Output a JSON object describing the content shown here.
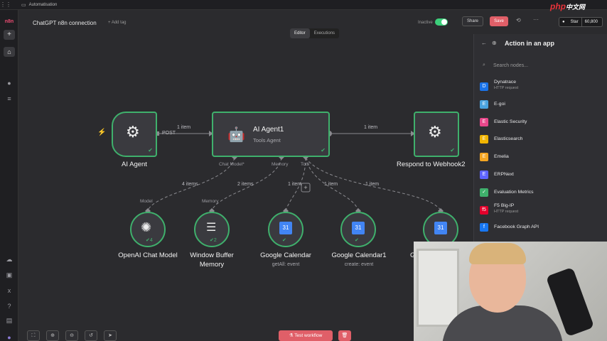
{
  "topbar": {
    "breadcrumb": "Automatisation"
  },
  "header": {
    "title": "ChatGPT n8n connection",
    "add_tag": "+ Add tag",
    "inactive": "Inactive",
    "share": "Share",
    "save": "Save",
    "star": "Star",
    "star_count": "60,800"
  },
  "tabs": {
    "editor": "Editor",
    "executions": "Executions"
  },
  "nodes": {
    "trigger": {
      "label": "AI Agent",
      "port_label": "POST"
    },
    "agent": {
      "label": "AI Agent1",
      "sub": "Tools Agent",
      "ports": [
        "Chat Model*",
        "Memory",
        "Tool"
      ]
    },
    "respond": {
      "label": "Respond to Webhook2"
    },
    "openai": {
      "label": "OpenAI Chat Model",
      "port": "Model",
      "count": "4"
    },
    "memory": {
      "label": "Window Buffer",
      "label2": "Memory",
      "port": "Memory",
      "count": "2"
    },
    "gcal": {
      "label": "Google Calendar",
      "sub": "getAll: event"
    },
    "gcal1": {
      "label": "Google Calendar1",
      "sub": "create: event"
    },
    "gcal2": {
      "label": "G"
    }
  },
  "edges": {
    "e1": "1 item",
    "e2": "1 item",
    "e3": "4 items",
    "e4": "2 items",
    "e5": "1 item",
    "e6": "1 item",
    "e7": "1 item"
  },
  "toolbar": {
    "test": "Test workflow"
  },
  "panel": {
    "title": "Action in an app",
    "search_placeholder": "Search nodes...",
    "items": [
      {
        "name": "Dynatrace",
        "desc": "HTTP request",
        "color": "#1a73e8",
        "icon": "D"
      },
      {
        "name": "E-goi",
        "desc": "",
        "color": "#4aa3df",
        "icon": "E"
      },
      {
        "name": "Elastic Security",
        "desc": "",
        "color": "#e8478b",
        "icon": "E"
      },
      {
        "name": "Elasticsearch",
        "desc": "",
        "color": "#f0b400",
        "icon": "E"
      },
      {
        "name": "Emelia",
        "desc": "",
        "color": "#f5a623",
        "icon": "E"
      },
      {
        "name": "ERPNext",
        "desc": "",
        "color": "#5e64ff",
        "icon": "E"
      },
      {
        "name": "Evaluation Metrics",
        "desc": "",
        "color": "#3fb06c",
        "icon": "✓"
      },
      {
        "name": "F5 Big-IP",
        "desc": "HTTP request",
        "color": "#e4002b",
        "icon": "f5"
      },
      {
        "name": "Facebook Graph API",
        "desc": "",
        "color": "#1877f2",
        "icon": "f"
      }
    ]
  },
  "watermark": "php中文网"
}
